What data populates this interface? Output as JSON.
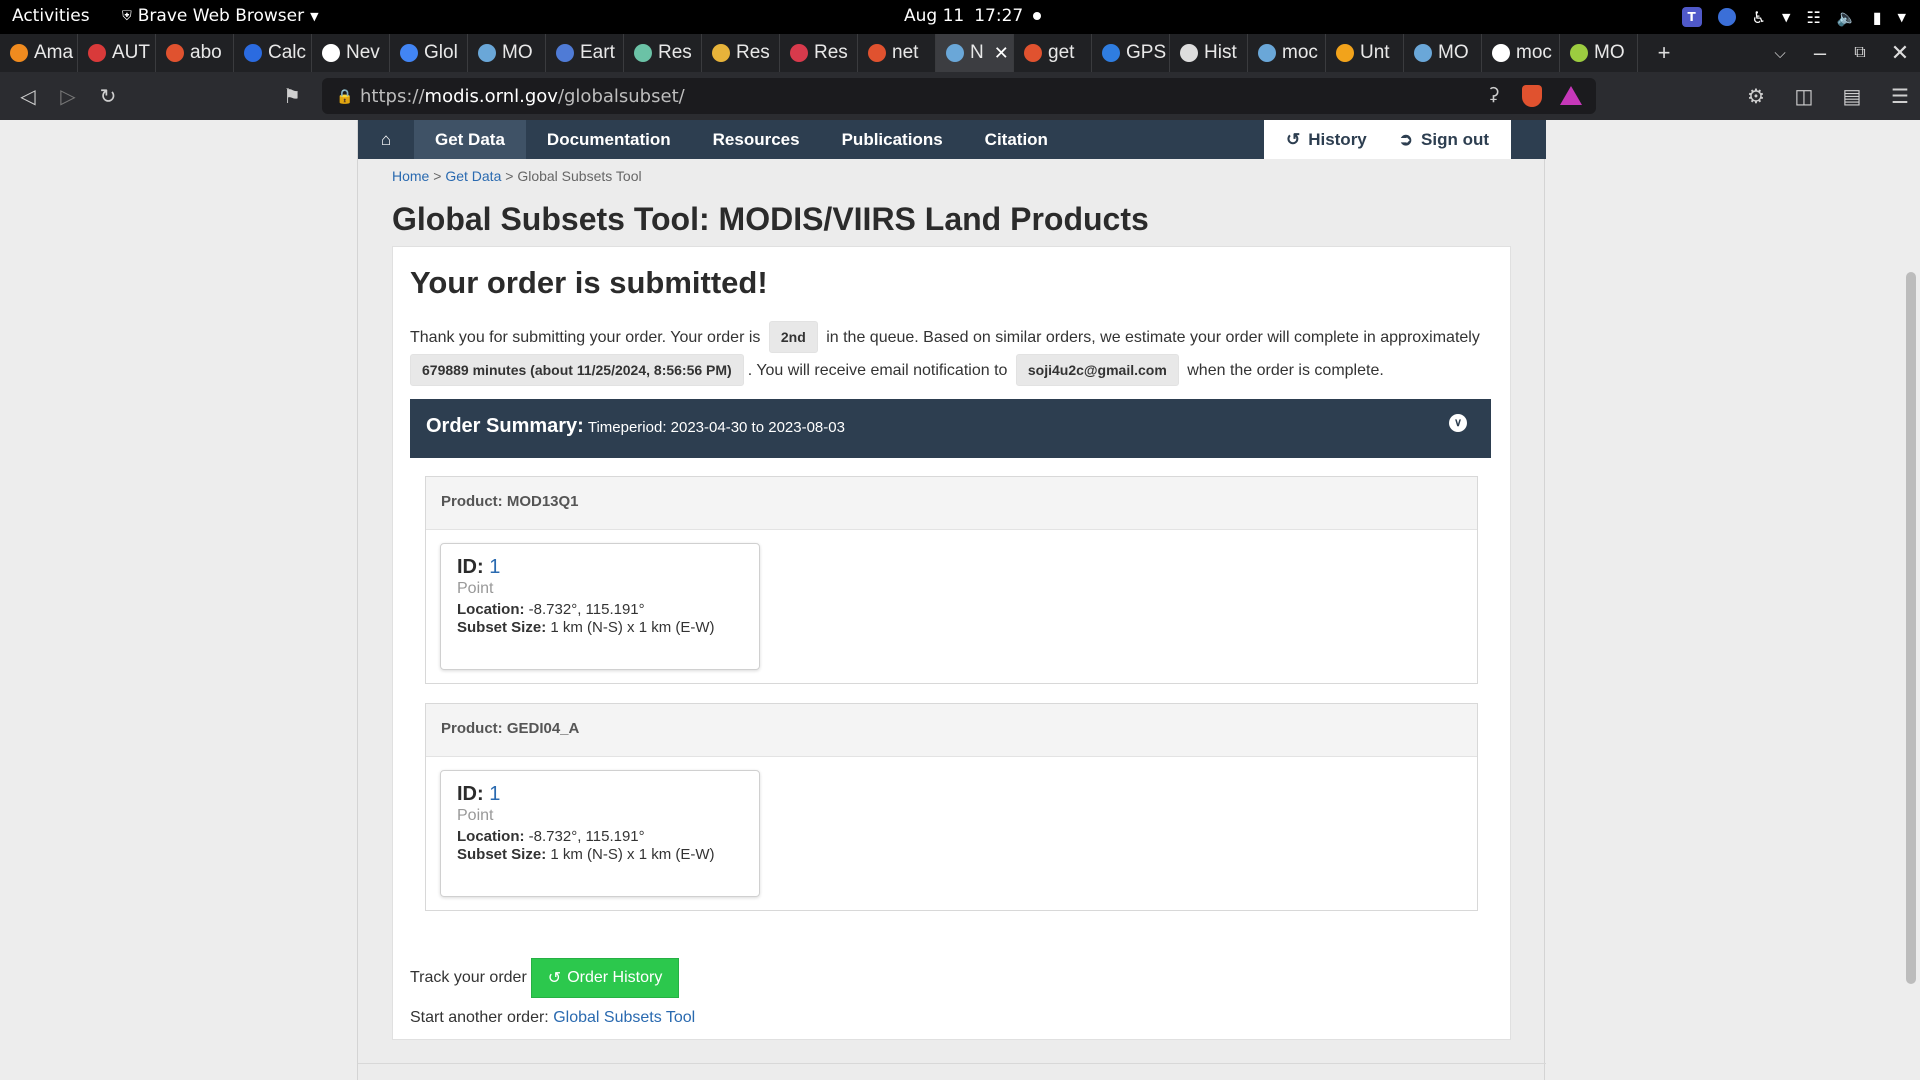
{
  "system_bar": {
    "activities": "Activities",
    "app_name": "Brave Web Browser",
    "date": "Aug 11",
    "time": "17:27"
  },
  "tabs": [
    {
      "label": "Ama",
      "icon": "amazon-icon",
      "color": "#f08b1f"
    },
    {
      "label": "AUT",
      "icon": "bookmark-red-icon",
      "color": "#d93a3a"
    },
    {
      "label": "abo",
      "icon": "brave-icon",
      "color": "#e0522f"
    },
    {
      "label": "Calc",
      "icon": "calc-icon",
      "color": "#2b6be0"
    },
    {
      "label": "Nev",
      "icon": "medium-icon",
      "color": "#ffffff"
    },
    {
      "label": "Glol",
      "icon": "google-icon",
      "color": "#4285f4"
    },
    {
      "label": "MO",
      "icon": "earth-icon",
      "color": "#6aa7d8"
    },
    {
      "label": "Eart",
      "icon": "earth-engine-icon",
      "color": "#4f7bd6"
    },
    {
      "label": "Res",
      "icon": "openai-icon",
      "color": "#6bc2a6"
    },
    {
      "label": "Res",
      "icon": "box-icon",
      "color": "#e7b33a"
    },
    {
      "label": "Res",
      "icon": "pocket-icon",
      "color": "#d83a4c"
    },
    {
      "label": "net",
      "icon": "brave-icon",
      "color": "#e0522f"
    },
    {
      "label": "N",
      "icon": "earth-icon",
      "color": "#6aa7d8",
      "active": true
    },
    {
      "label": "get",
      "icon": "brave-icon",
      "color": "#e0522f"
    },
    {
      "label": "GPS",
      "icon": "gps-icon",
      "color": "#2f7de0"
    },
    {
      "label": "Hist",
      "icon": "history-icon",
      "color": "#dddddd"
    },
    {
      "label": "moc",
      "icon": "earth-icon",
      "color": "#6aa7d8"
    },
    {
      "label": "Unt",
      "icon": "colab-icon",
      "color": "#f2a31b"
    },
    {
      "label": "MO",
      "icon": "earth-icon",
      "color": "#6aa7d8"
    },
    {
      "label": "moc",
      "icon": "github-icon",
      "color": "#ffffff"
    },
    {
      "label": "MO",
      "icon": "android-icon",
      "color": "#9ccc40"
    }
  ],
  "url": {
    "prefix": "https://",
    "host": "modis.ornl.gov",
    "path": "/globalsubset/"
  },
  "nav": {
    "home": "home",
    "items": [
      "Get Data",
      "Documentation",
      "Resources",
      "Publications",
      "Citation"
    ],
    "active_index": 0,
    "history": "History",
    "sign_out": "Sign out"
  },
  "breadcrumb": {
    "home": "Home",
    "get_data": "Get Data",
    "current": "Global Subsets Tool",
    "sep": ">"
  },
  "page_title": "Global Subsets Tool: MODIS/VIIRS Land Products",
  "order": {
    "heading": "Your order is submitted!",
    "text1": "Thank you for submitting your order. Your order is",
    "queue_position": "2nd",
    "text2": "in the queue. Based on similar orders, we estimate your order will complete in approximately",
    "estimate": "679889 minutes (about 11/25/2024, 8:56:56 PM)",
    "text3": ". You will receive email notification to",
    "email": "soji4u2c@gmail.com",
    "text4": "when the order is complete."
  },
  "summary": {
    "title": "Order Summary:",
    "timeperiod": "Timeperiod: 2023-04-30 to 2023-08-03"
  },
  "products": [
    {
      "header": "Product: MOD13Q1",
      "id_label": "ID:",
      "id_value": "1",
      "type": "Point",
      "location_label": "Location:",
      "location": "-8.732°, 115.191°",
      "size_label": "Subset Size:",
      "size": "1 km (N-S) x 1 km (E-W)"
    },
    {
      "header": "Product: GEDI04_A",
      "id_label": "ID:",
      "id_value": "1",
      "type": "Point",
      "location_label": "Location:",
      "location": "-8.732°, 115.191°",
      "size_label": "Subset Size:",
      "size": "1 km (N-S) x 1 km (E-W)"
    }
  ],
  "track": {
    "label": "Track your order",
    "button": "Order History"
  },
  "another": {
    "label": "Start another order:",
    "link": "Global Subsets Tool"
  },
  "colors": {
    "nav_bg": "#2d3e50",
    "link": "#2a6ab0",
    "button_green": "#2cc84d"
  }
}
